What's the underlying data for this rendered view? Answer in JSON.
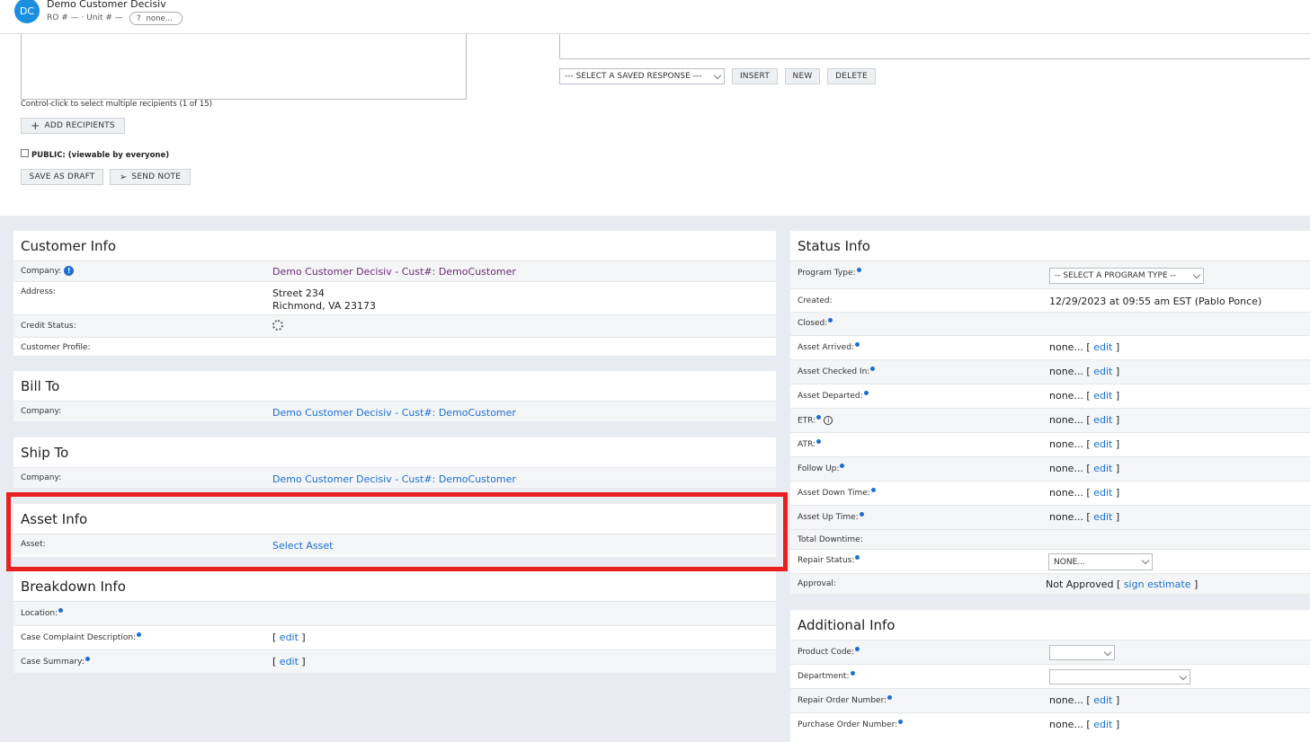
{
  "header": {
    "avatar_initials": "DC",
    "title": "Demo Customer Decisiv",
    "sub": "RO # — · Unit # —",
    "chip_icon": "?",
    "chip_label": "none..."
  },
  "composer": {
    "hint": "Control-click to select multiple recipients (1 of 15)",
    "add_recipients": "ADD RECIPIENTS",
    "public_label": "PUBLIC: (viewable by everyone)",
    "save_draft": "SAVE AS DRAFT",
    "send_note": "SEND NOTE",
    "saved_response_select": "--- SELECT A SAVED RESPONSE ---",
    "insert": "INSERT",
    "new": "NEW",
    "delete": "DELETE"
  },
  "customer_info": {
    "title": "Customer Info",
    "company_label": "Company:",
    "company_value": "Demo Customer Decisiv - Cust#: DemoCustomer",
    "address_label": "Address:",
    "address_line1": "Street 234",
    "address_line2": "Richmond, VA 23173",
    "credit_label": "Credit Status:",
    "profile_label": "Customer Profile:"
  },
  "bill_to": {
    "title": "Bill To",
    "company_label": "Company:",
    "company_value": "Demo Customer Decisiv - Cust#: DemoCustomer"
  },
  "ship_to": {
    "title": "Ship To",
    "company_label": "Company:",
    "company_value": "Demo Customer Decisiv - Cust#: DemoCustomer"
  },
  "asset_info": {
    "title": "Asset Info",
    "asset_label": "Asset:",
    "asset_value": "Select Asset"
  },
  "breakdown_info": {
    "title": "Breakdown Info",
    "location_label": "Location:",
    "complaint_label": "Case Complaint Description:",
    "summary_label": "Case Summary:",
    "edit": "edit"
  },
  "status_info": {
    "title": "Status Info",
    "program_type_label": "Program Type:",
    "program_type_select": "-- SELECT A PROGRAM TYPE --",
    "created_label": "Created:",
    "created_value": "12/29/2023 at 09:55 am EST (Pablo Ponce)",
    "closed_label": "Closed:",
    "rows": [
      {
        "label": "Asset Arrived:",
        "value": "none..."
      },
      {
        "label": "Asset Checked In:",
        "value": "none..."
      },
      {
        "label": "Asset Departed:",
        "value": "none..."
      },
      {
        "label": "ETR:",
        "value": "none..."
      },
      {
        "label": "ATR:",
        "value": "none..."
      },
      {
        "label": "Follow Up:",
        "value": "none..."
      },
      {
        "label": "Asset Down Time:",
        "value": "none..."
      },
      {
        "label": "Asset Up Time:",
        "value": "none..."
      }
    ],
    "edit": "edit",
    "total_downtime_label": "Total Downtime:",
    "repair_status_label": "Repair Status:",
    "repair_status_select": "NONE...",
    "approval_label": "Approval:",
    "approval_value": "Not Approved",
    "sign_estimate": "sign estimate"
  },
  "additional_info": {
    "title": "Additional Info",
    "product_code_label": "Product Code:",
    "department_label": "Department:",
    "repair_order_label": "Repair Order Number:",
    "repair_order_value": "none...",
    "purchase_order_label": "Purchase Order Number:",
    "purchase_order_value": "none...",
    "edit": "edit"
  },
  "colors": {
    "link": "#1a6fd0",
    "company_purple": "#6a2c7a",
    "highlight": "#e8201f",
    "background": "#e8ecf2"
  }
}
